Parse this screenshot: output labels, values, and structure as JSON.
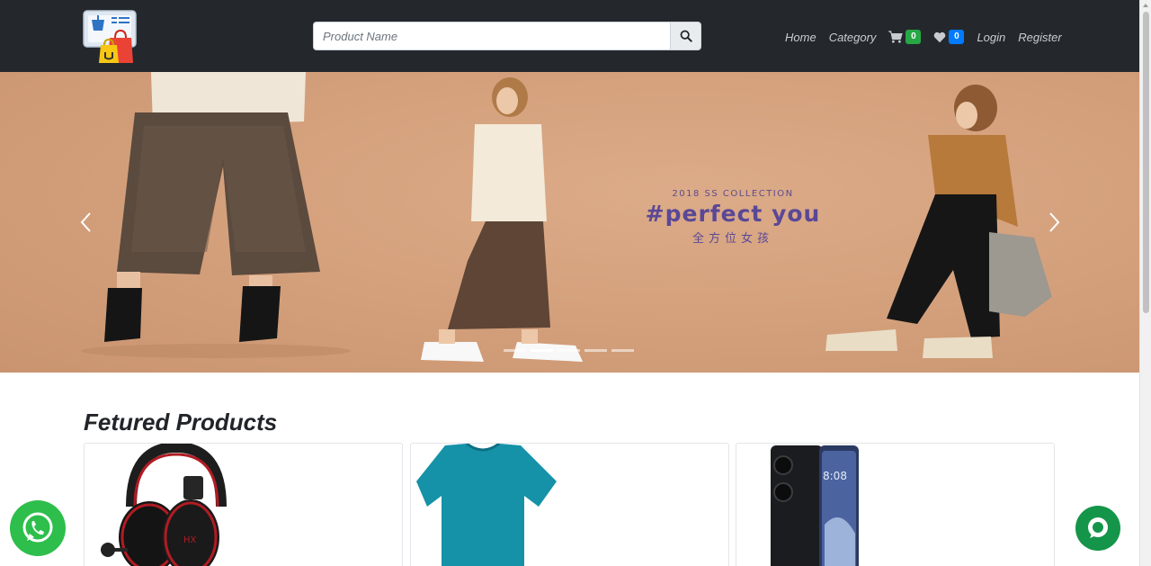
{
  "navbar": {
    "logo_icon": "shopping-bags-logo-icon",
    "search": {
      "placeholder": "Product Name",
      "icon": "search-icon"
    },
    "links": {
      "home": "Home",
      "category": "Category",
      "login": "Login",
      "register": "Register"
    },
    "cart": {
      "icon": "cart-icon",
      "count": "0",
      "color": "#28a745"
    },
    "wishlist": {
      "icon": "heart-icon",
      "count": "0",
      "color": "#007bff"
    }
  },
  "hero": {
    "subtitle": "2018 SS COLLECTION",
    "title": "#perfect you",
    "caption_cn": "全方位女孩",
    "indicator_count": 5,
    "active_indicator": 1,
    "prev_icon": "chevron-left-icon",
    "next_icon": "chevron-right-icon"
  },
  "featured": {
    "title": "Fetured Products",
    "products": [
      {
        "image": "headphones-image"
      },
      {
        "image": "blue-tshirt-image"
      },
      {
        "image": "smartphone-image"
      }
    ]
  },
  "floating": {
    "whatsapp_icon": "whatsapp-icon",
    "whatsapp_color": "#2dbe4c",
    "chat_icon": "chat-bubble-icon",
    "chat_color": "#14954a"
  },
  "colors": {
    "navbar_bg": "#24282d",
    "hero_bg": "#d9a784",
    "hero_text": "#5a4896"
  }
}
